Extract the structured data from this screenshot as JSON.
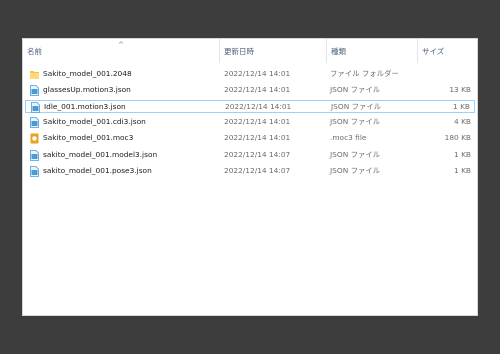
{
  "header": {
    "name_label": "名前",
    "date_label": "更新日時",
    "type_label": "種類",
    "size_label": "サイズ",
    "sort_indicator": "^"
  },
  "files": [
    {
      "name": "Sakito_model_001.2048",
      "date": "2022/12/14 14:01",
      "type": "ファイル フォルダー",
      "size": "",
      "icon": "folder-icon"
    },
    {
      "name": "glassesUp.motion3.json",
      "date": "2022/12/14 14:01",
      "type": "JSON ファイル",
      "size": "13 KB",
      "icon": "json-file-icon"
    },
    {
      "name": "Idle_001.motion3.json",
      "date": "2022/12/14 14:01",
      "type": "JSON ファイル",
      "size": "1 KB",
      "icon": "json-file-icon"
    },
    {
      "name": "Sakito_model_001.cdi3.json",
      "date": "2022/12/14 14:01",
      "type": "JSON ファイル",
      "size": "4 KB",
      "icon": "json-file-icon"
    },
    {
      "name": "Sakito_model_001.moc3",
      "date": "2022/12/14 14:01",
      "type": ".moc3 file",
      "size": "180 KB",
      "icon": "moc3-file-icon"
    },
    {
      "name": "sakito_model_001.model3.json",
      "date": "2022/12/14 14:07",
      "type": "JSON ファイル",
      "size": "1 KB",
      "icon": "json-file-icon"
    },
    {
      "name": "sakito_model_001.pose3.json",
      "date": "2022/12/14 14:07",
      "type": "JSON ファイル",
      "size": "1 KB",
      "icon": "json-file-icon"
    }
  ],
  "colors": {
    "background": "#3d3d3d",
    "window": "#ffffff",
    "selection_border": "#99d1ff",
    "folder": "#f5c64d",
    "json_icon": "#4a9ad8",
    "moc3_icon": "#e8a21c"
  }
}
